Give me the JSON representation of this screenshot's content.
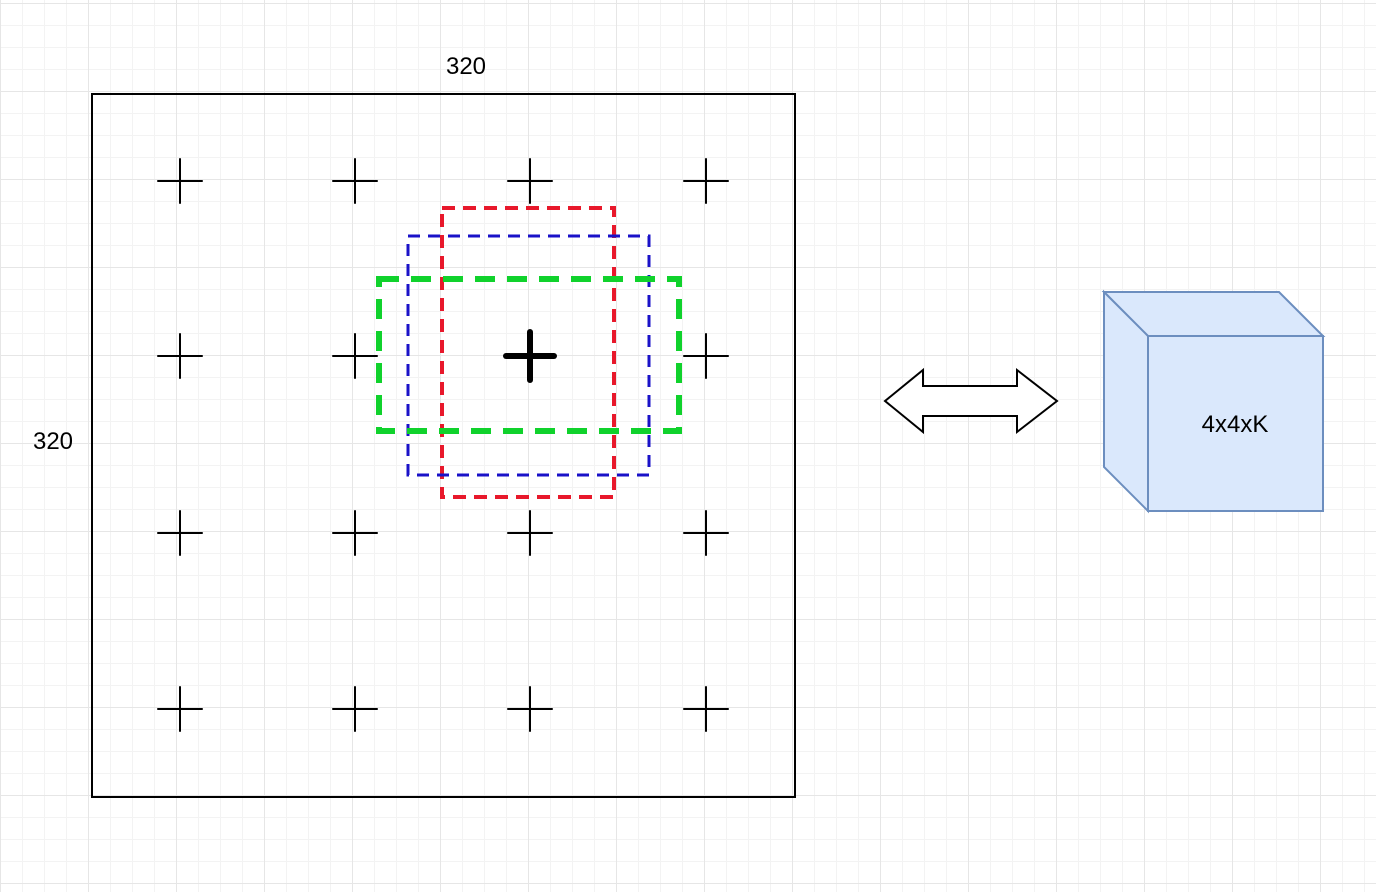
{
  "labels": {
    "width_label": "320",
    "height_label": "320",
    "cube_label": "4x4xK"
  },
  "grid": {
    "rows": 4,
    "cols": 4,
    "highlighted_cell": {
      "row": 1,
      "col": 2
    }
  },
  "boxes": [
    {
      "name": "red-dashed-box",
      "color": "#e8182b"
    },
    {
      "name": "blue-dashed-box",
      "color": "#1a12c8"
    },
    {
      "name": "green-dashed-box",
      "color": "#10d22c"
    }
  ],
  "colors": {
    "frame": "#000000",
    "cube_fill": "#dae8fc",
    "cube_stroke": "#6c8ebf",
    "arrow_stroke": "#000000"
  },
  "icons": {
    "connector": "double-headed-arrow-icon",
    "tensor": "cube-icon"
  }
}
